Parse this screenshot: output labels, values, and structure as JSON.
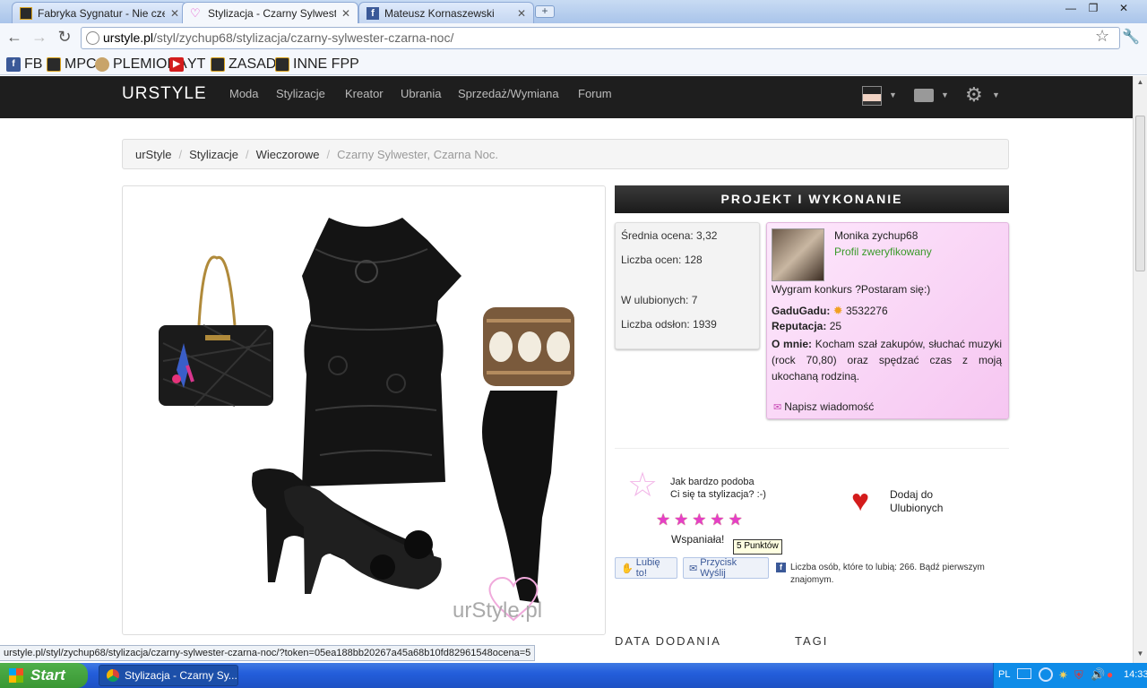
{
  "browser": {
    "tabs": [
      {
        "label": "Fabryka Sygnatur - Nie czekaj",
        "icon": "fpp-icon"
      },
      {
        "label": "Stylizacja - Czarny Sylwester,",
        "icon": "urstyle-icon"
      },
      {
        "label": "Mateusz Kornaszewski",
        "icon": "facebook-icon"
      }
    ],
    "close_glyph": "✕",
    "new_tab_glyph": "+",
    "url_host": "urstyle.pl",
    "url_path": "/styl/zychup68/stylizacja/czarny-sylwester-czarna-noc/",
    "bookmarks": [
      {
        "label": "FB",
        "icon": "facebook-icon"
      },
      {
        "label": "MPC",
        "icon": "fpp-icon"
      },
      {
        "label": "PLEMIONA",
        "icon": "plemiona-icon"
      },
      {
        "label": "YT",
        "icon": "youtube-icon"
      },
      {
        "label": "ZASADY",
        "icon": "fpp-icon"
      },
      {
        "label": "INNE FPP",
        "icon": "fpp-icon"
      }
    ],
    "status_url": "urstyle.pl/styl/zychup68/stylizacja/czarny-sylwester-czarna-noc/?token=05ea188bb20267a45a68b10fd82961548ocena=5"
  },
  "site": {
    "brand": "URSTYLE",
    "nav": [
      "Moda",
      "Stylizacje",
      "Kreator",
      "Ubrania",
      "Sprzedaż/Wymiana",
      "Forum"
    ]
  },
  "breadcrumb": [
    "urStyle",
    "Stylizacje",
    "Wieczorowe",
    "Czarny Sylwester, Czarna Noc."
  ],
  "breadcrumb_sep": "/",
  "photo": {
    "watermark": "urStyle.pl"
  },
  "project": {
    "header": "PROJEKT I WYKONANIE",
    "avg_rating": "Średnia ocena: 3,32",
    "rating_count": "Liczba ocen: 128",
    "favorites": "W ulubionych: 7",
    "views": "Liczba odsłon: 1939"
  },
  "author": {
    "name": "Monika zychup68",
    "verified": "Profil zweryfikowany",
    "motto": "Wygram konkurs ?Postaram się:)",
    "gg_label": "GaduGadu:",
    "gg_number": "3532276",
    "rep_label": "Reputacja:",
    "rep_value": "25",
    "about_label": "O mnie:",
    "about_text": "Kocham szał zakupów, słuchać muzyki (rock 70,80) oraz spędzać czas z moją ukochaną rodziną.",
    "message_link": "Napisz wiadomość"
  },
  "rating": {
    "question_line1": "Jak bardzo podoba",
    "question_line2": "Ci się ta stylizacja? :-)",
    "stars": 5,
    "star_glyph": "★",
    "label": "Wspaniała!",
    "tooltip": "5 Punktów"
  },
  "favorites_widget": {
    "line1": "Dodaj do",
    "line2": "Ulubionych"
  },
  "social": {
    "like": "Lubię to!",
    "wysil": "Przycisk Wyślij",
    "like_count": "Liczba osób, które to lubią: 266. Bądź pierwszym",
    "like_count2": "znajomym."
  },
  "sections": [
    "DATA DODANIA",
    "TAGI"
  ],
  "taskbar": {
    "start": "Start",
    "task": "Stylizacja - Czarny Sy...",
    "lang": "PL",
    "time": "14:33"
  },
  "colors": {
    "navbar": "#1e1e1e",
    "accent_pink": "#e53fc7",
    "verified_green": "#3a9a2a"
  }
}
